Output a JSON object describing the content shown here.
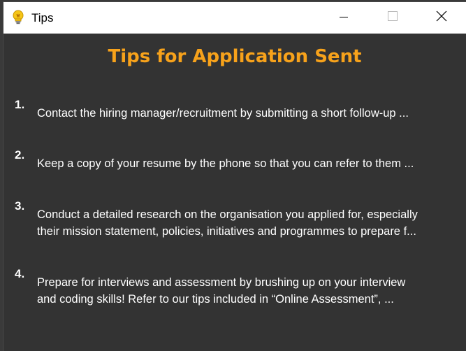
{
  "window": {
    "title": "Tips",
    "icon": "lightbulb-icon",
    "controls": {
      "minimize_icon": "minimize-icon",
      "maximize_icon": "maximize-icon",
      "close_icon": "close-icon"
    }
  },
  "colors": {
    "heading": "#f7a21b",
    "background": "#333333",
    "text": "#ffffff",
    "titlebar": "#ffffff"
  },
  "main": {
    "heading": "Tips for Application Sent",
    "tips": [
      {
        "number": "1.",
        "text": "Contact the hiring manager/recruitment by submitting a short follow-up ..."
      },
      {
        "number": "2.",
        "text": "Keep a copy of your resume by the phone so that you can refer to them ..."
      },
      {
        "number": "3.",
        "text": "Conduct a detailed research on the organisation you applied for, especially\ntheir mission statement, policies, initiatives and programmes to prepare f..."
      },
      {
        "number": "4.",
        "text": "Prepare for interviews and assessment by brushing up on your interview\nand coding skills! Refer to our tips included in “Online Assessment”, ..."
      }
    ]
  }
}
